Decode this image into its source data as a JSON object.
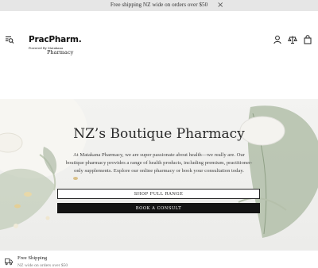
{
  "announcement": {
    "text": "Free shipping NZ wide on orders over $50",
    "close_glyph": "×"
  },
  "header": {
    "menu_icon": "menu-search-icon",
    "logo": {
      "main": "PracPharm.",
      "sub": "Powered By Matakana",
      "pharmacy": "Pharmacy"
    },
    "icons": [
      "account-icon",
      "compare-icon",
      "cart-icon"
    ]
  },
  "hero": {
    "title": "NZ’s Boutique Pharmacy",
    "copy": "At Matakana Pharmacy, we are super passionate about health—we really are. Our boutique pharmacy provides a range of health products, including premium, practitioner-only supplements. Explore our online pharmacy or book your consultation today.",
    "shop_button": "SHOP FULL RANGE",
    "consult_button": "BOOK A CONSULT"
  },
  "feature": {
    "title": "Free Shipping",
    "subtitle": "NZ wide on orders over $50",
    "icon": "truck-icon"
  },
  "colors": {
    "announcement_bg": "#e6e6e6",
    "button_dark": "#141414",
    "hero_bg": "#efefed"
  }
}
